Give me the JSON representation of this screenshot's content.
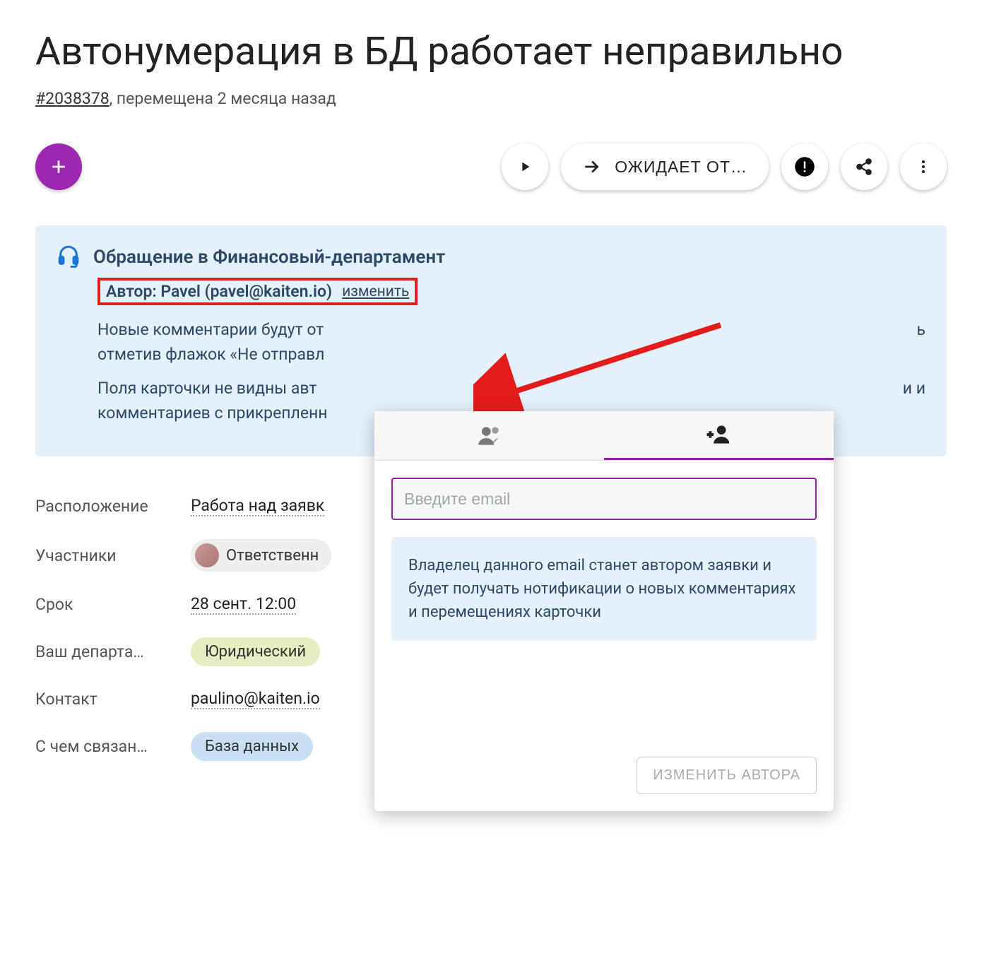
{
  "title": "Автонумерация в БД работает неправильно",
  "meta": {
    "issue_id": "#2038378",
    "moved_text": ", перемещена 2 месяца назад"
  },
  "toolbar": {
    "status_label": "ОЖИДАЕТ ОТ…"
  },
  "request": {
    "heading": "Обращение в Финансовый-департамент",
    "author_label": "Автор: Pavel (pavel@kaiten.io)",
    "change_label": "изменить",
    "line1": "Новые комментарии будут от",
    "line1_end": "ь",
    "line2": "отметив флажок «Не отправл",
    "line3": "Поля карточки не видны авт",
    "line3_end": "и и",
    "line4": "комментариев с прикрепленн"
  },
  "fields": {
    "location_label": "Расположение",
    "location_value": "Работа над заявк",
    "members_label": "Участники",
    "members_chip": "Ответственн",
    "due_label": "Срок",
    "due_value": "28 сент. 12:00",
    "dept_label": "Ваш департа…",
    "dept_value": "Юридический",
    "contact_label": "Контакт",
    "contact_value": "paulino@kaiten.io",
    "related_label": "С чем связан…",
    "related_value": "База данных"
  },
  "popup": {
    "email_placeholder": "Введите email",
    "info_text": "Владелец данного email станет автором заявки и будет получать нотификации о новых комментариях и перемещениях карточки",
    "submit_label": "ИЗМЕНИТЬ АВТОРА"
  }
}
